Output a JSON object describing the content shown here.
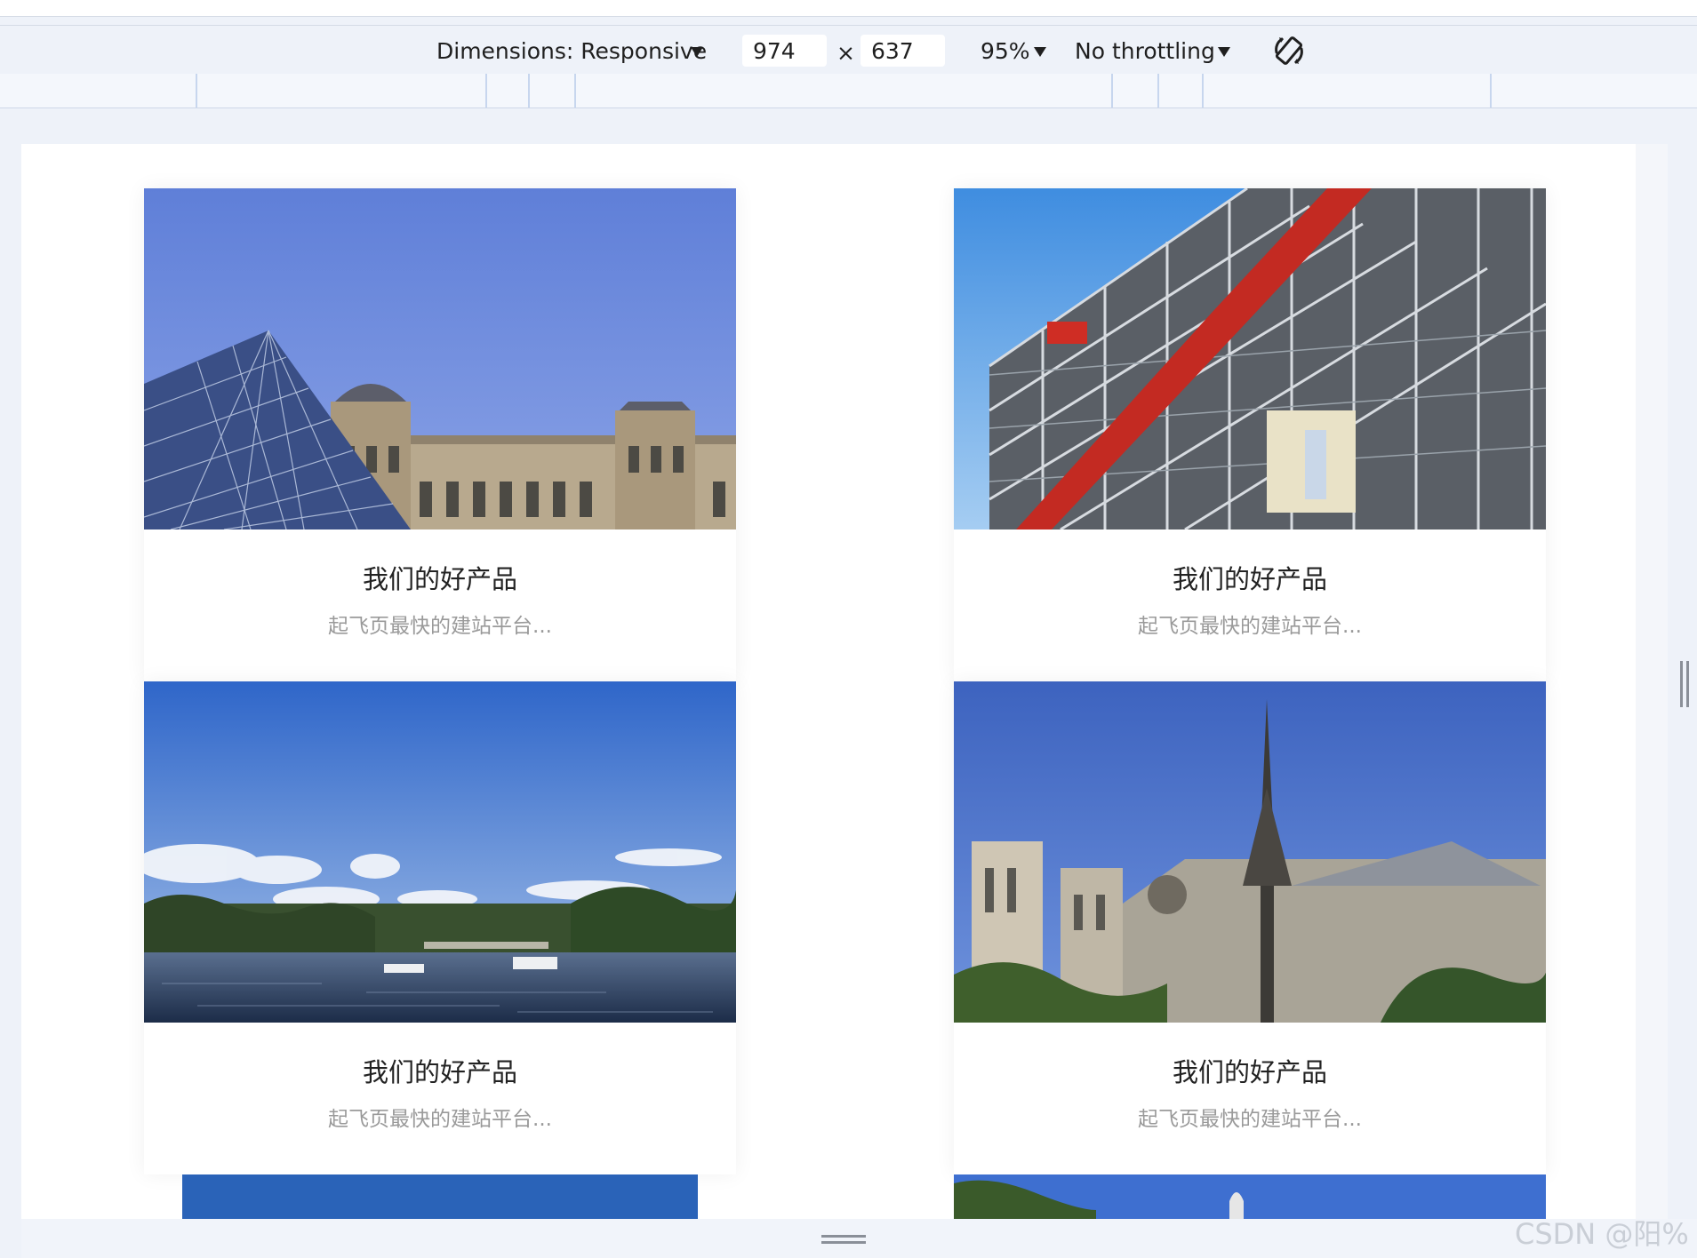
{
  "devtools": {
    "dimensions_label": "Dimensions: Responsive",
    "width_value": "974",
    "times_sign": "×",
    "height_value": "637",
    "zoom_label": "95%",
    "throttling_label": "No throttling",
    "rotate_icon": "rotate-device-icon"
  },
  "cards": [
    {
      "image": "louvre-pyramid",
      "title": "我们的好产品",
      "desc": "起飞页最快的建站平台..."
    },
    {
      "image": "pompidou-centre",
      "title": "我们的好产品",
      "desc": "起飞页最快的建站平台..."
    },
    {
      "image": "seine-river",
      "title": "我们的好产品",
      "desc": "起飞页最快的建站平台..."
    },
    {
      "image": "notre-dame",
      "title": "我们的好产品",
      "desc": "起飞页最快的建站平台..."
    }
  ],
  "watermark": "CSDN @阳%",
  "colors": {
    "toolbar_bg": "#eef2f9",
    "sky_blue": "#5b7fd8",
    "title_text": "#222222",
    "desc_text": "#9a9a9a"
  }
}
